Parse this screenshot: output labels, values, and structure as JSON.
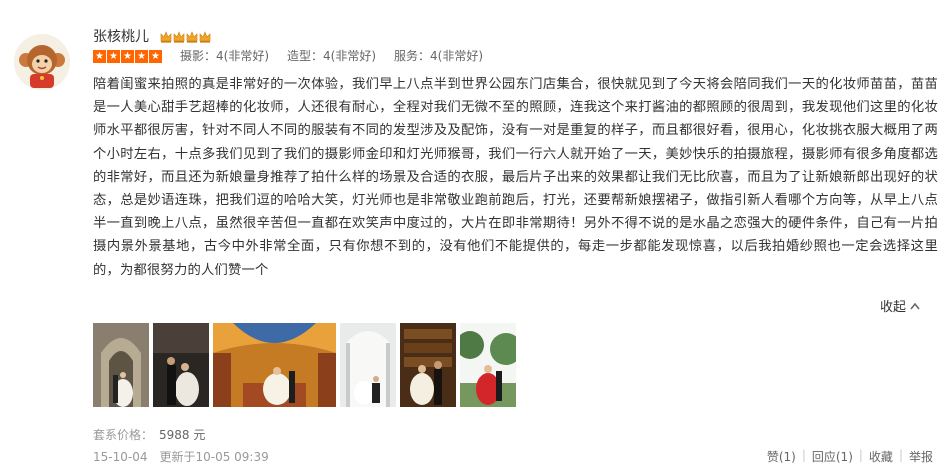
{
  "reviewer": {
    "name": "张核桃儿",
    "crown_count": 4,
    "crown_icon": "crown-icon",
    "avatar_icon": "monkey-avatar-icon"
  },
  "rating": {
    "stars": 5,
    "star_color": "#ff6600",
    "scores": [
      {
        "text": "摄影：4(非常好)"
      },
      {
        "text": "造型：4(非常好)"
      },
      {
        "text": "服务：4(非常好)"
      }
    ]
  },
  "review": {
    "text": "陪着闺蜜来拍照的真是非常好的一次体验，我们早上八点半到世界公园东门店集合，很快就见到了今天将会陪同我们一天的化妆师苗苗，苗苗是一人美心甜手艺超棒的化妆师，人还很有耐心，全程对我们无微不至的照顾，连我这个来打酱油的都照顾的很周到，我发现他们这里的化妆师水平都很厉害，针对不同人不同的服装有不同的发型涉及及配饰，没有一对是重复的样子，而且都很好看，很用心，化妆挑衣服大概用了两个小时左右，十点多我们见到了我们的摄影师金印和灯光师猴哥，我们一行六人就开始了一天，美妙快乐的拍摄旅程，摄影师有很多角度都选的非常好，而且还为新娘量身推荐了拍什么样的场景及合适的衣服，最后片子出来的效果都让我们无比欣喜，而且为了让新娘新郎出现好的状态，总是妙语连珠，把我们逗的哈哈大笑，灯光师也是非常敬业跑前跑后，打光，还要帮新娘摆裙子，做指引新人看哪个方向等，从早上八点半一直到晚上八点，虽然很辛苦但一直都在欢笑声中度过的，大片在即非常期待！另外不得不说的是水晶之恋强大的硬件条件，自己有一片拍摄内景外景基地，古今中外非常全面，只有你想不到的，没有他们不能提供的，每走一步都能发现惊喜，以后我拍婚纱照也一定会选择这里的，为都很努力的人们赞一个",
    "collapse_label": "收起"
  },
  "photos": [
    {
      "name": "photo-church-couple"
    },
    {
      "name": "photo-dark-couple"
    },
    {
      "name": "photo-colorful-hall"
    },
    {
      "name": "photo-white-hall"
    },
    {
      "name": "photo-library-couple"
    },
    {
      "name": "photo-red-dress-garden"
    }
  ],
  "package_price": {
    "label": "套系价格：",
    "value": "5988 元"
  },
  "meta": {
    "date": "15-10-04",
    "updated": "更新于10-05 09:39"
  },
  "actions": {
    "like": "赞(1)",
    "reply": "回应(1)",
    "favorite": "收藏",
    "report": "举报"
  }
}
